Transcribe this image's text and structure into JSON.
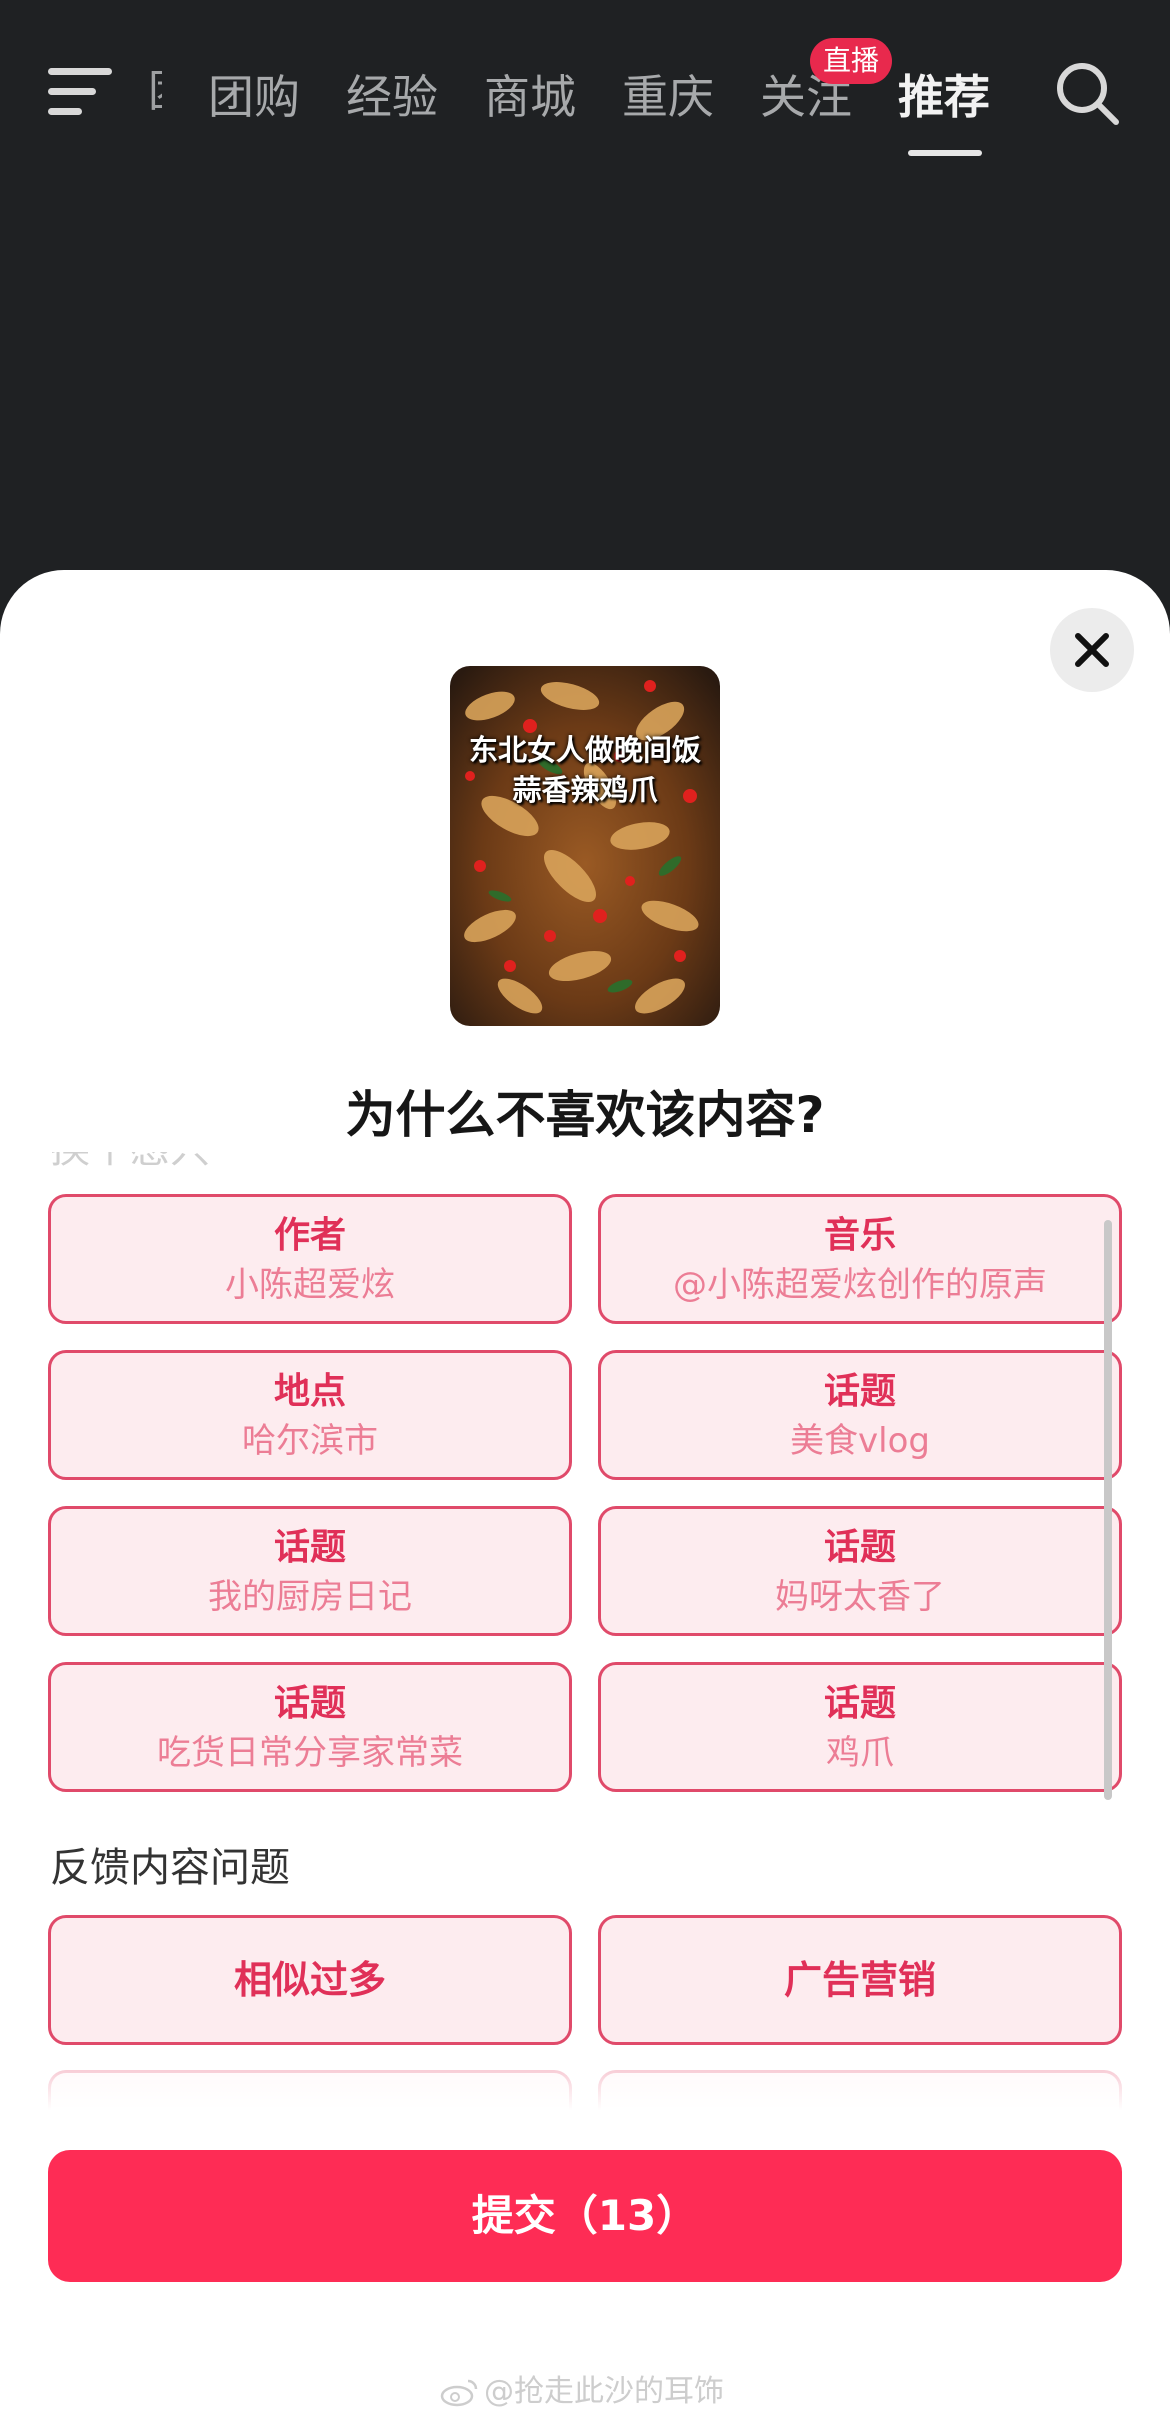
{
  "nav": {
    "tabs": [
      {
        "label": "团购"
      },
      {
        "label": "经验"
      },
      {
        "label": "商城"
      },
      {
        "label": "重庆"
      },
      {
        "label": "关注"
      },
      {
        "label": "推荐"
      }
    ],
    "active_tab": "推荐",
    "live_badge": "直播",
    "cut_tab_label": "团"
  },
  "sheet": {
    "thumbnail_caption_line1": "东北女人做晚间饭",
    "thumbnail_caption_line2": "蒜香辣鸡爪",
    "title": "为什么不喜欢该内容?",
    "clipped_section_label": "换个感兴",
    "reasons": [
      {
        "title": "作者",
        "value": "小陈超爱炫"
      },
      {
        "title": "音乐",
        "value": "@小陈超爱炫创作的原声"
      },
      {
        "title": "地点",
        "value": "哈尔滨市"
      },
      {
        "title": "话题",
        "value": "美食vlog"
      },
      {
        "title": "话题",
        "value": "我的厨房日记"
      },
      {
        "title": "话题",
        "value": "妈呀太香了"
      },
      {
        "title": "话题",
        "value": "吃货日常分享家常菜"
      },
      {
        "title": "话题",
        "value": "鸡爪"
      }
    ],
    "feedback_section_label": "反馈内容问题",
    "feedback_options": [
      {
        "label": "相似过多"
      },
      {
        "label": "广告营销"
      }
    ],
    "submit_label": "提交（13）"
  },
  "watermark": "@抢走此沙的耳饰",
  "colors": {
    "accent": "#fe2c55",
    "chip_border": "#e04a6a",
    "chip_bg": "#fdecef",
    "chip_title": "#e03058",
    "chip_sub": "#ec7d95",
    "topbar_bg": "#1f2123",
    "live_badge": "#e8294d"
  },
  "icons": [
    "menu-icon",
    "search-icon",
    "close-icon",
    "weibo-icon"
  ]
}
